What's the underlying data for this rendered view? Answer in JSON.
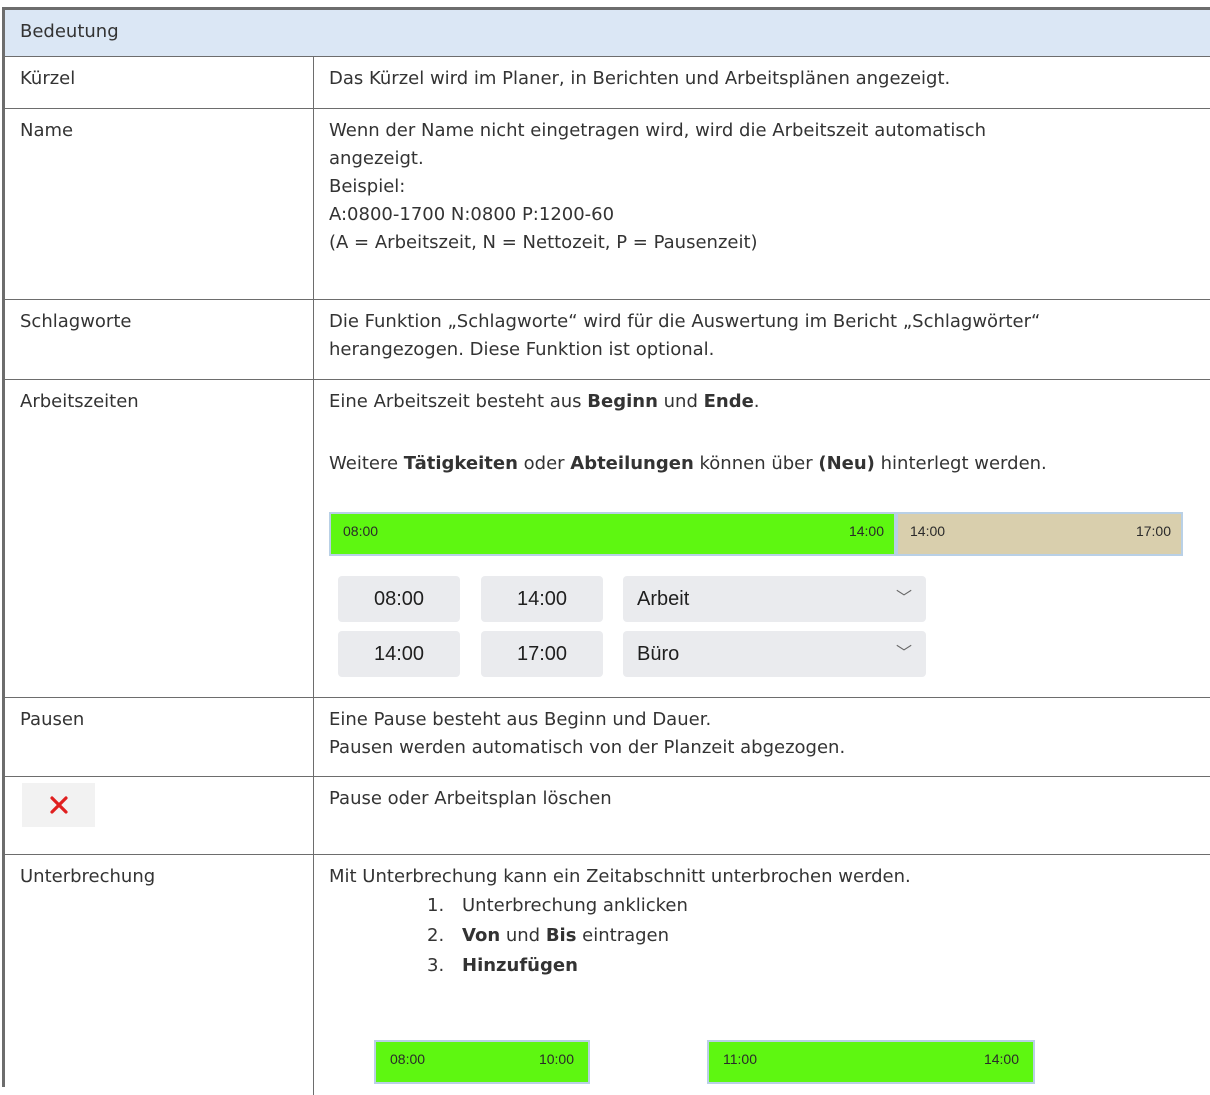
{
  "header": {
    "title": "Bedeutung"
  },
  "rows": {
    "kuerzel": {
      "label": "Kürzel",
      "text": "Das Kürzel wird im Planer, in Berichten und Arbeitsplänen angezeigt."
    },
    "name": {
      "label": "Name",
      "lines": [
        "Wenn der Name nicht eingetragen wird, wird die Arbeitszeit automatisch",
        "angezeigt.",
        "Beispiel:",
        "A:0800-1700 N:0800 P:1200-60",
        "(A = Arbeitszeit, N = Nettozeit, P = Pausenzeit)"
      ]
    },
    "schlagworte": {
      "label": "Schlagworte",
      "lines": [
        "Die Funktion „Schlagworte“ wird für die Auswertung im Bericht „Schlagwörter“",
        "herangezogen. Diese Funktion ist optional."
      ]
    },
    "arbeitszeiten": {
      "label": "Arbeitszeiten",
      "s1_a": "Eine Arbeitszeit besteht aus ",
      "s1_b": "Beginn",
      "s1_c": " und ",
      "s1_d": "Ende",
      "s1_e": ".",
      "s2_a": "Weitere ",
      "s2_b": "Tätigkeiten",
      "s2_c": " oder ",
      "s2_d": "Abteilungen",
      "s2_e": " können über ",
      "s2_f": "(Neu)",
      "s2_g": " hinterlegt werden.",
      "bar": {
        "seg1_start": "08:00",
        "seg1_end": "14:00",
        "seg2_start": "14:00",
        "seg2_end": "17:00",
        "seg1_color": "#5ef711",
        "seg2_color": "#d9cfad"
      },
      "shifts": [
        {
          "from": "08:00",
          "to": "14:00",
          "activity": "Arbeit"
        },
        {
          "from": "14:00",
          "to": "17:00",
          "activity": "Büro"
        }
      ]
    },
    "pausen": {
      "label": "Pausen",
      "lines": [
        "Eine Pause besteht aus Beginn und Dauer.",
        "Pausen werden automatisch von der Planzeit abgezogen."
      ]
    },
    "loeschen": {
      "icon": "close-icon",
      "text": "Pause oder Arbeitsplan löschen"
    },
    "unterbrechung": {
      "label": "Unterbrechung",
      "intro": "Mit Unterbrechung kann ein Zeitabschnitt unterbrochen werden.",
      "steps": {
        "n1": "1.",
        "s1": "Unterbrechung anklicken",
        "n2": "2.",
        "s2_a": "Von",
        "s2_b": " und ",
        "s2_c": "Bis",
        "s2_d": " eintragen",
        "n3": "3.",
        "s3": "Hinzufügen"
      },
      "bars": [
        {
          "start": "08:00",
          "end": "10:00"
        },
        {
          "start": "11:00",
          "end": "14:00"
        }
      ]
    }
  }
}
